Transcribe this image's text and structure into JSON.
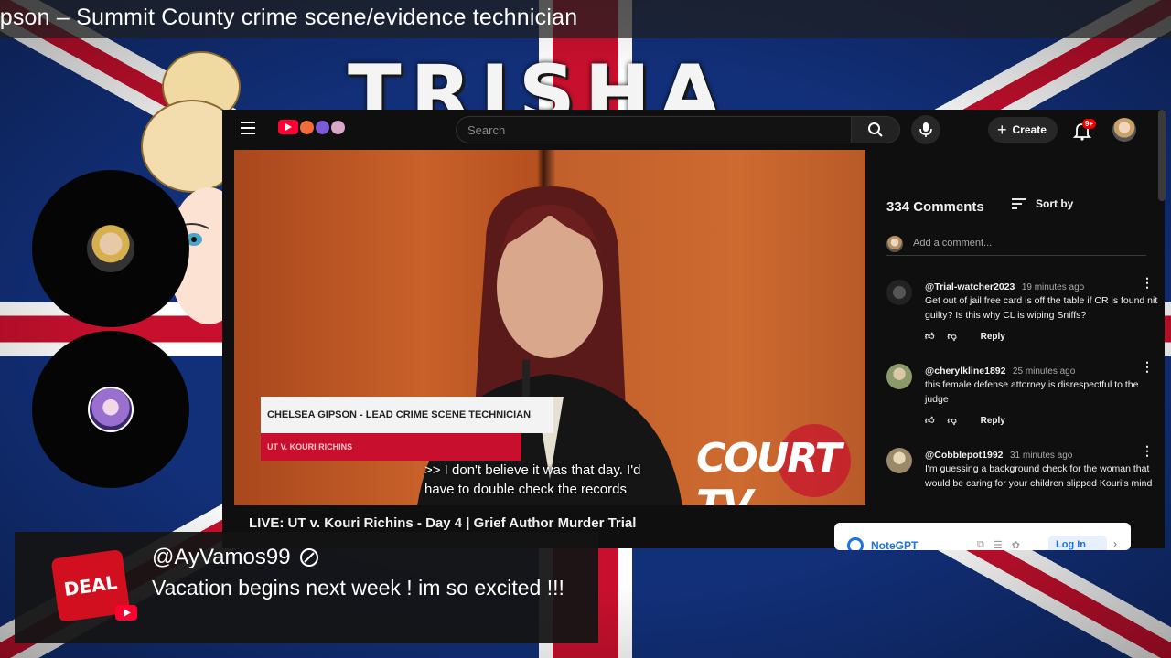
{
  "stream_title": "ipson – Summit County crime scene/evidence technician",
  "banner_word": "TRISHA",
  "youtube": {
    "search_placeholder": "Search",
    "create_label": "Create",
    "notification_badge": "9+"
  },
  "video": {
    "lower_third_name": "CHELSEA GIPSON - LEAD CRIME SCENE TECHNICIAN",
    "lower_third_case": "UT V. KOURI RICHINS",
    "caption": ">> I don't believe it was that day. I'd\nhave to double check the records",
    "network_logo": "COURT TV",
    "title": "LIVE: UT v. Kouri Richins - Day 4 | Grief Author Murder Trial"
  },
  "comments": {
    "count_label": "334 Comments",
    "sort_label": "Sort by",
    "add_placeholder": "Add a comment...",
    "items": [
      {
        "user": "@Trial-watcher2023",
        "time": "19 minutes ago",
        "text": "Get out of jail free card is off the table if CR is found nit guilty? Is this why CL is wiping Sniffs?",
        "reply_label": "Reply"
      },
      {
        "user": "@cherylkline1892",
        "time": "25 minutes ago",
        "text": "this female defense attorney is disrespectful to the judge",
        "reply_label": "Reply"
      },
      {
        "user": "@Cobblepot1992",
        "time": "31 minutes ago",
        "text": "I'm guessing a background check for the woman that would be caring for your children slipped Kouri's mind",
        "reply_label": ""
      }
    ]
  },
  "notegpt": {
    "name": "NoteGPT",
    "login_label": "Log In"
  },
  "chat_highlight": {
    "username": "@AyVamos99",
    "message": "Vacation begins next week ! im so excited !!!",
    "icon_text": "DEAL"
  },
  "colors": {
    "accent_red": "#c8102e",
    "flag_blue": "#12307a",
    "youtube_red": "#ff0033",
    "notegpt_blue": "#1a73e8"
  }
}
